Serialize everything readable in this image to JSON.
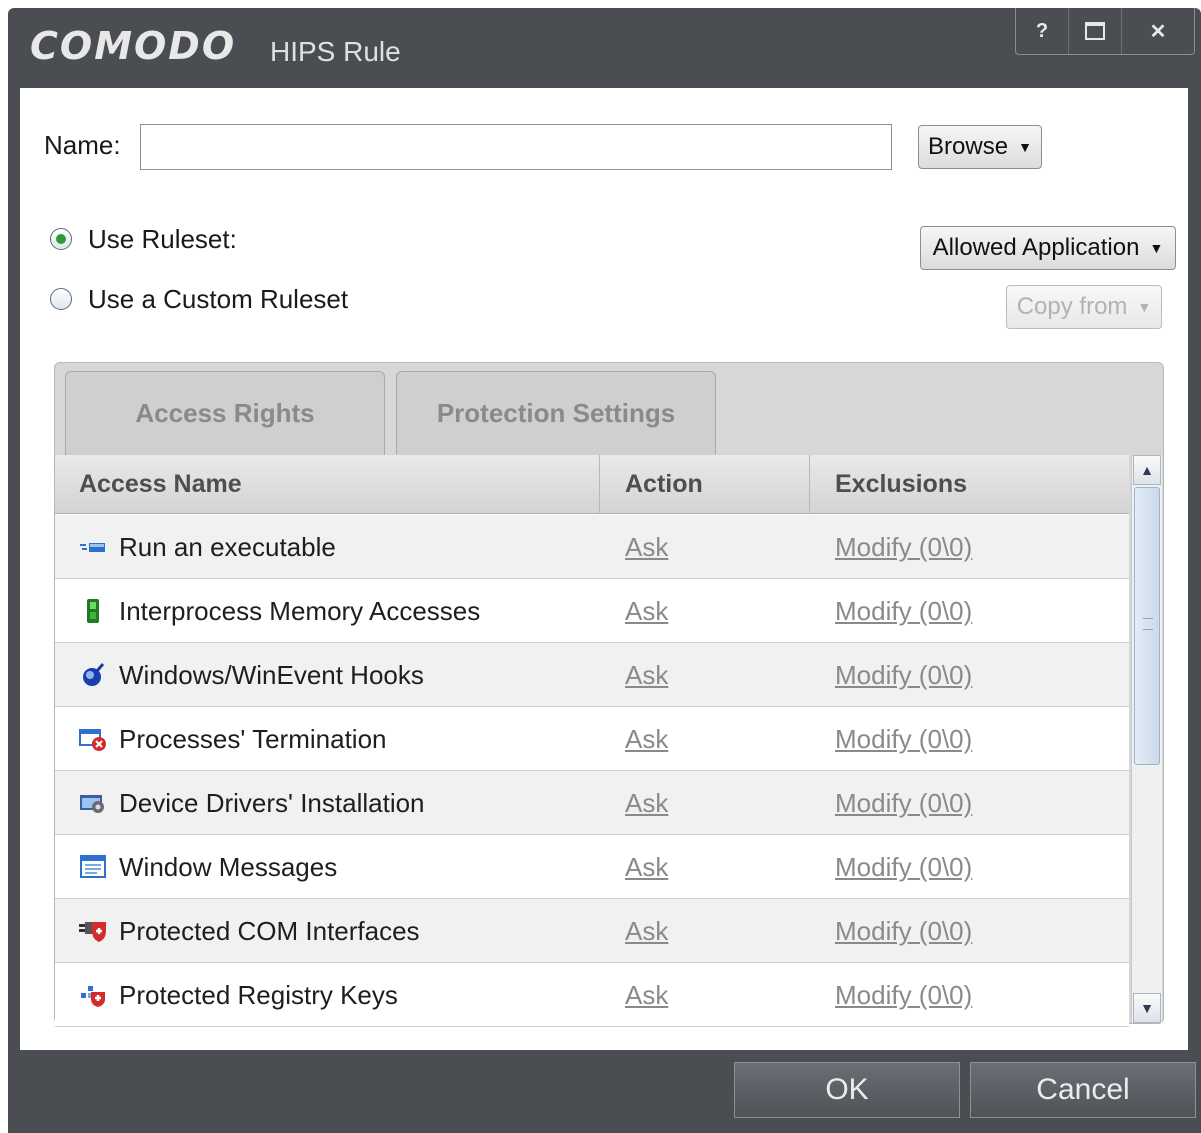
{
  "window": {
    "logo": "COMODO",
    "title": "HIPS Rule",
    "help": "?",
    "close": "✕"
  },
  "form": {
    "name_label": "Name:",
    "name_value": "",
    "browse_label": "Browse",
    "use_ruleset_label": "Use Ruleset:",
    "use_ruleset_checked": true,
    "ruleset_value": "Allowed Application",
    "custom_ruleset_label": "Use a Custom Ruleset",
    "custom_ruleset_checked": false,
    "copy_from_label": "Copy from"
  },
  "tabs": [
    {
      "label": "Access Rights"
    },
    {
      "label": "Protection Settings"
    }
  ],
  "table": {
    "columns": [
      "Access Name",
      "Action",
      "Exclusions"
    ],
    "rows": [
      {
        "icon": "run-executable-icon",
        "name": "Run an executable",
        "action": "Ask",
        "exclusions": "Modify (0\\0)"
      },
      {
        "icon": "memory-icon",
        "name": "Interprocess Memory Accesses",
        "action": "Ask",
        "exclusions": "Modify (0\\0)"
      },
      {
        "icon": "hooks-icon",
        "name": "Windows/WinEvent Hooks",
        "action": "Ask",
        "exclusions": "Modify (0\\0)"
      },
      {
        "icon": "termination-icon",
        "name": "Processes' Termination",
        "action": "Ask",
        "exclusions": "Modify (0\\0)"
      },
      {
        "icon": "driver-icon",
        "name": "Device Drivers' Installation",
        "action": "Ask",
        "exclusions": "Modify (0\\0)"
      },
      {
        "icon": "window-messages-icon",
        "name": "Window Messages",
        "action": "Ask",
        "exclusions": "Modify (0\\0)"
      },
      {
        "icon": "com-interface-icon",
        "name": "Protected COM Interfaces",
        "action": "Ask",
        "exclusions": "Modify (0\\0)"
      },
      {
        "icon": "registry-icon",
        "name": "Protected Registry Keys",
        "action": "Ask",
        "exclusions": "Modify (0\\0)"
      }
    ]
  },
  "footer": {
    "ok_label": "OK",
    "cancel_label": "Cancel"
  },
  "colors": {
    "chrome": "#4a4e53",
    "radio_selected": "#2e9b35",
    "link_gray": "#8a8a8a"
  }
}
